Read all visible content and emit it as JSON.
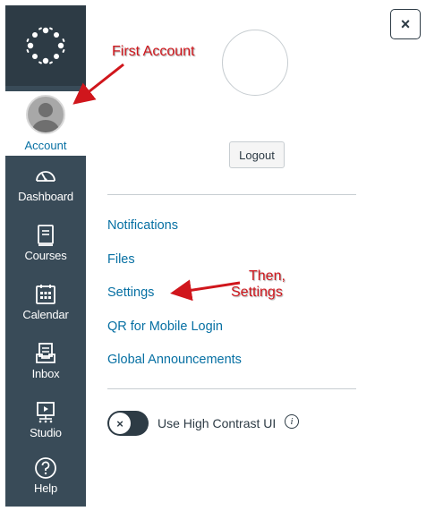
{
  "nav": {
    "account": "Account",
    "dashboard": "Dashboard",
    "courses": "Courses",
    "calendar": "Calendar",
    "inbox": "Inbox",
    "studio": "Studio",
    "help": "Help"
  },
  "tray": {
    "close_label": "×",
    "logout_label": "Logout",
    "links": [
      "Notifications",
      "Files",
      "Settings",
      "QR for Mobile Login",
      "Global Announcements"
    ],
    "toggle_knob": "×",
    "toggle_label": "Use High Contrast UI",
    "info_label": "i"
  },
  "annotations": {
    "first": "First Account",
    "then_line1": "Then,",
    "then_line2": "Settings"
  },
  "colors": {
    "nav_bg": "#394b58",
    "nav_logo_bg": "#2d3b45",
    "link": "#0770a3",
    "annotation": "#d0161c"
  },
  "icons": [
    "canvas-logo-icon",
    "avatar-icon",
    "dashboard-icon",
    "courses-icon",
    "calendar-icon",
    "inbox-icon",
    "studio-icon",
    "help-icon",
    "close-icon",
    "info-icon"
  ]
}
